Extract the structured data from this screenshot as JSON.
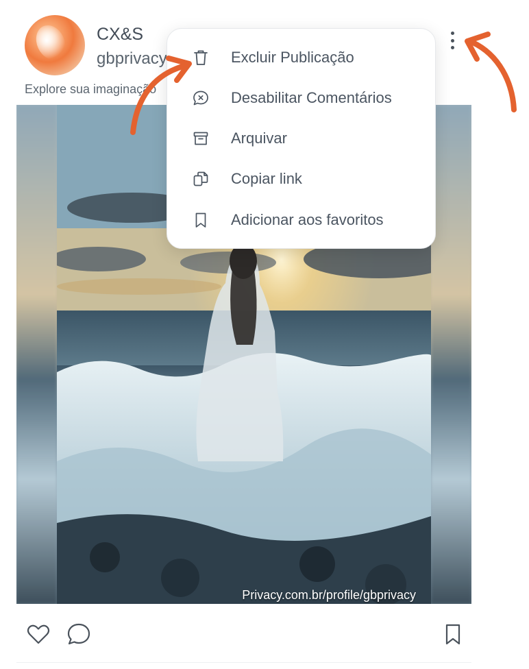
{
  "post": {
    "author_name": "CX&S",
    "author_handle": "gbprivacy",
    "caption": "Explore sua imaginação",
    "watermark": "Privacy.com.br/profile/gbprivacy"
  },
  "menu": {
    "items": [
      {
        "label": "Excluir Publicação",
        "icon": "trash-icon"
      },
      {
        "label": "Desabilitar Comentários",
        "icon": "comment-off-icon"
      },
      {
        "label": "Arquivar",
        "icon": "archive-icon"
      },
      {
        "label": "Copiar link",
        "icon": "copy-icon"
      },
      {
        "label": "Adicionar aos favoritos",
        "icon": "bookmark-icon"
      }
    ]
  },
  "actions": {
    "like_icon": "heart-icon",
    "comment_icon": "comment-icon",
    "save_icon": "bookmark-icon"
  },
  "colors": {
    "annotation_arrow": "#e4622f",
    "text": "#4b5561",
    "menu_background": "#ffffff"
  }
}
